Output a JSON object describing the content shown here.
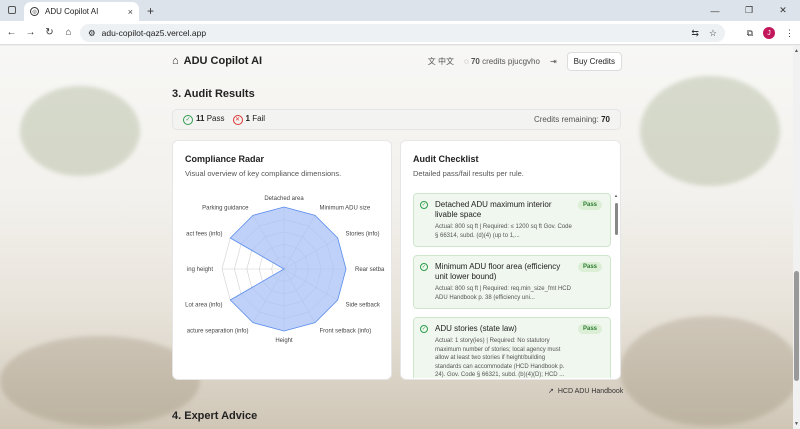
{
  "browser": {
    "tab_title": "ADU Copilot AI",
    "tab_close": "×",
    "new_tab": "+",
    "url": "adu-copilot-qaz5.vercel.app",
    "profile_initial": "J"
  },
  "header": {
    "brand": "ADU Copilot AI",
    "language": "中文",
    "credits": "70",
    "credits_label": "credits",
    "username": "pjucgvho",
    "buy_credits": "Buy Credits"
  },
  "audit": {
    "title": "3. Audit Results",
    "pass_count": "11",
    "pass_label": "Pass",
    "fail_count": "1",
    "fail_label": "Fail",
    "credits_remaining_label": "Credits remaining:",
    "credits_remaining": "70"
  },
  "radar_card": {
    "title": "Compliance Radar",
    "subtitle": "Visual overview of key compliance dimensions."
  },
  "chart_data": {
    "type": "radar",
    "categories": [
      "Detached area",
      "Minimum ADU size",
      "Stories (info)",
      "Rear setback",
      "Side setback",
      "Front setback (info)",
      "Height",
      "Structure separation (info)",
      "Lot area (info)",
      "Parking height",
      "Impact fees (info)",
      "Parking guidance"
    ],
    "displayed_labels": [
      "Detached area",
      "Minimum ADU size",
      "Stories (info)",
      "Rear setba",
      "Side setback",
      "Front setback (info)",
      "Height",
      "acture separation (info)",
      "Lot area (info)",
      "ing height",
      "act fees (info)",
      "Parking guidance"
    ],
    "values": [
      100,
      100,
      100,
      100,
      100,
      100,
      100,
      100,
      100,
      0,
      100,
      100
    ],
    "rmax": 100,
    "grid_levels": 5,
    "fill": "#a9c2f5",
    "stroke": "#5b8def"
  },
  "checklist": {
    "title": "Audit Checklist",
    "subtitle": "Detailed pass/fail results per rule.",
    "items": [
      {
        "title": "Detached ADU maximum interior livable space",
        "detail": "Actual: 800 sq ft | Required: ≤ 1200 sq ft Gov. Code § 66314, subd. (d)(4) (up to 1,...",
        "status": "Pass"
      },
      {
        "title": "Minimum ADU floor area (efficiency unit lower bound)",
        "detail": "Actual: 800 sq ft | Required: req.min_size_fmt HCD ADU Handbook p. 38 (efficiency uni...",
        "status": "Pass"
      },
      {
        "title": "ADU stories (state law)",
        "detail": "Actual: 1 story(ies) | Required: No statutory maximum number of stories; local agency must allow at least two stories if height/building standards can accommodate (HCD Handbook p. 24). Gov. Code § 66321, subd. (b)(4)(D); HCD ...",
        "status": "Pass"
      }
    ],
    "link": "HCD ADU Handbook"
  },
  "expert": {
    "title": "4. Expert Advice"
  },
  "colors": {
    "pass_green": "#2e9d4d",
    "fail_red": "#dd3333",
    "radar_fill": "#a9c2f5"
  }
}
